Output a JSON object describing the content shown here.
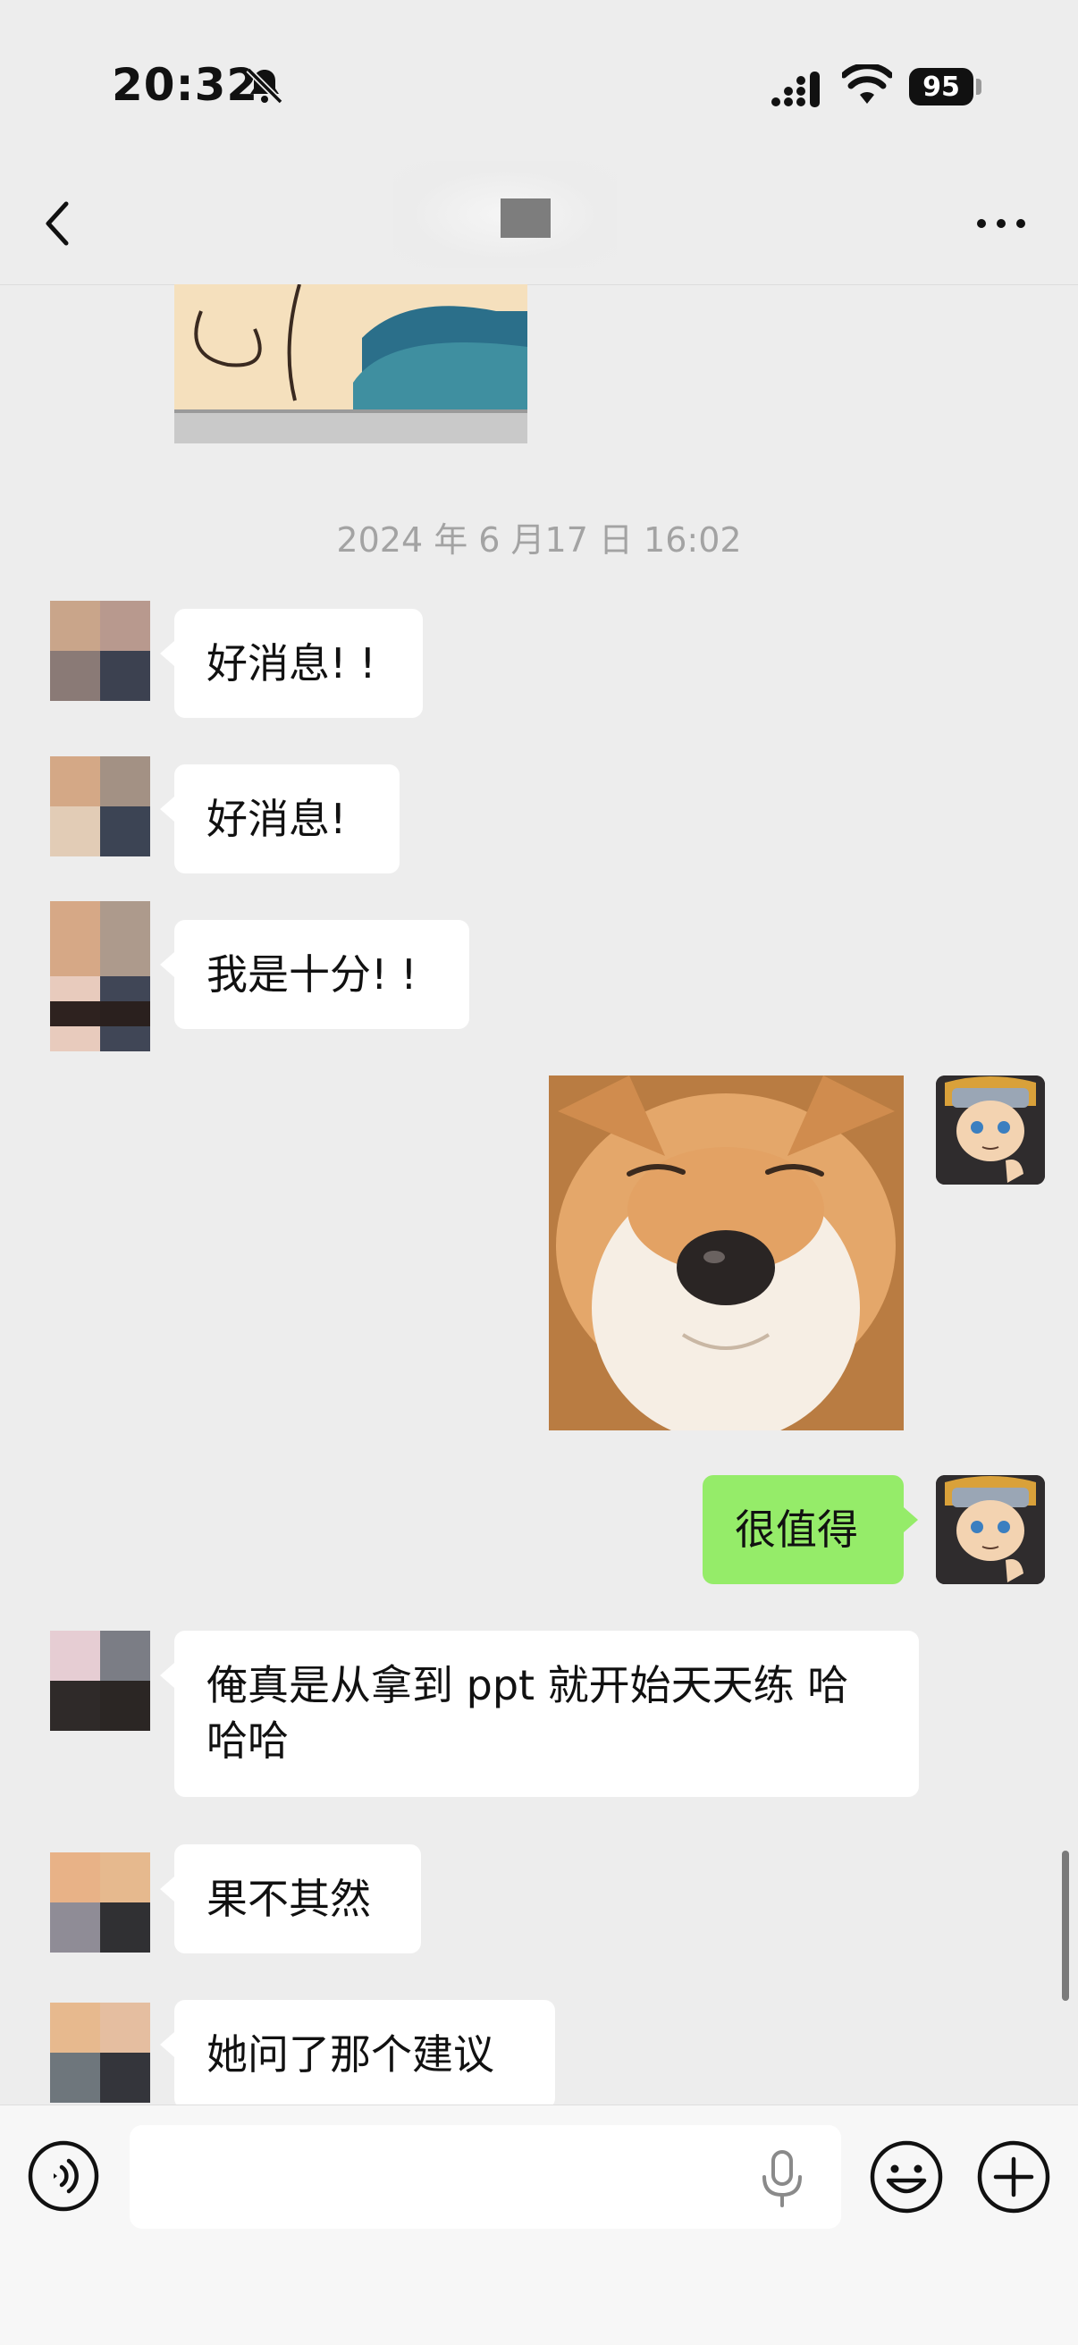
{
  "status_bar": {
    "time": "20:32",
    "battery": "95",
    "icons": [
      "bell-slash-icon",
      "signal-icon",
      "wifi-icon",
      "battery-icon"
    ]
  },
  "nav": {
    "back_icon": "chevron-left-icon",
    "more_icon": "ellipsis-icon"
  },
  "chat": {
    "timestamp": "2024 年 6 月17 日 16:02",
    "messages": [
      {
        "side": "left",
        "text": "好消息! !"
      },
      {
        "side": "left",
        "text": "好消息!"
      },
      {
        "side": "left",
        "text": "我是十分! !"
      },
      {
        "side": "right",
        "type": "sticker",
        "sticker": "shiba-dog-sticker"
      },
      {
        "side": "right",
        "text": "很值得"
      },
      {
        "side": "left",
        "text_line1": "俺真是从拿到 ppt 就开始天天练 哈",
        "text_line2": "哈哈"
      },
      {
        "side": "left",
        "text": "果不其然"
      },
      {
        "side": "left",
        "text": "她问了那个建议"
      }
    ]
  },
  "input_bar": {
    "value": "",
    "icons": [
      "voice-icon",
      "mic-icon",
      "emoji-icon",
      "plus-icon"
    ]
  },
  "colors": {
    "background": "#ededed",
    "bubble_incoming": "#ffffff",
    "bubble_outgoing": "#95ec69",
    "timestamp": "#a3a3a3"
  }
}
